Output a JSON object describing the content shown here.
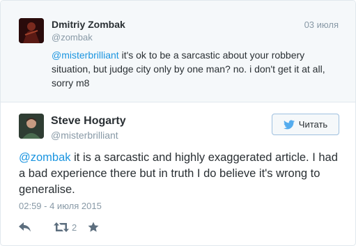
{
  "parent_tweet": {
    "author_name": "Dmitriy Zombak",
    "author_handle": "@zombak",
    "date": "03 июля",
    "mention": "@misterbrilliant",
    "text": " it's ok to be a sarcastic about your robbery situation, but judge city only by one man? no. i don't get it at all, sorry m8"
  },
  "tweet": {
    "author_name": "Steve Hogarty",
    "author_handle": "@misterbrilliant",
    "follow_label": "Читать",
    "mention": "@zombak",
    "text": " it is a sarcastic and highly exaggerated article. I had a bad experience there but in truth I do believe it's wrong to generalise.",
    "timestamp": "02:59 - 4 июля 2015",
    "retweet_count": "2"
  },
  "icons": {
    "follow": "twitter-bird-icon",
    "reply": "reply-icon",
    "retweet": "retweet-icon",
    "favorite": "star-icon"
  },
  "colors": {
    "link": "#1b95e0",
    "muted": "#8899a6",
    "text": "#292f33",
    "bird": "#55acee",
    "action_icon": "#5c6e7e"
  }
}
